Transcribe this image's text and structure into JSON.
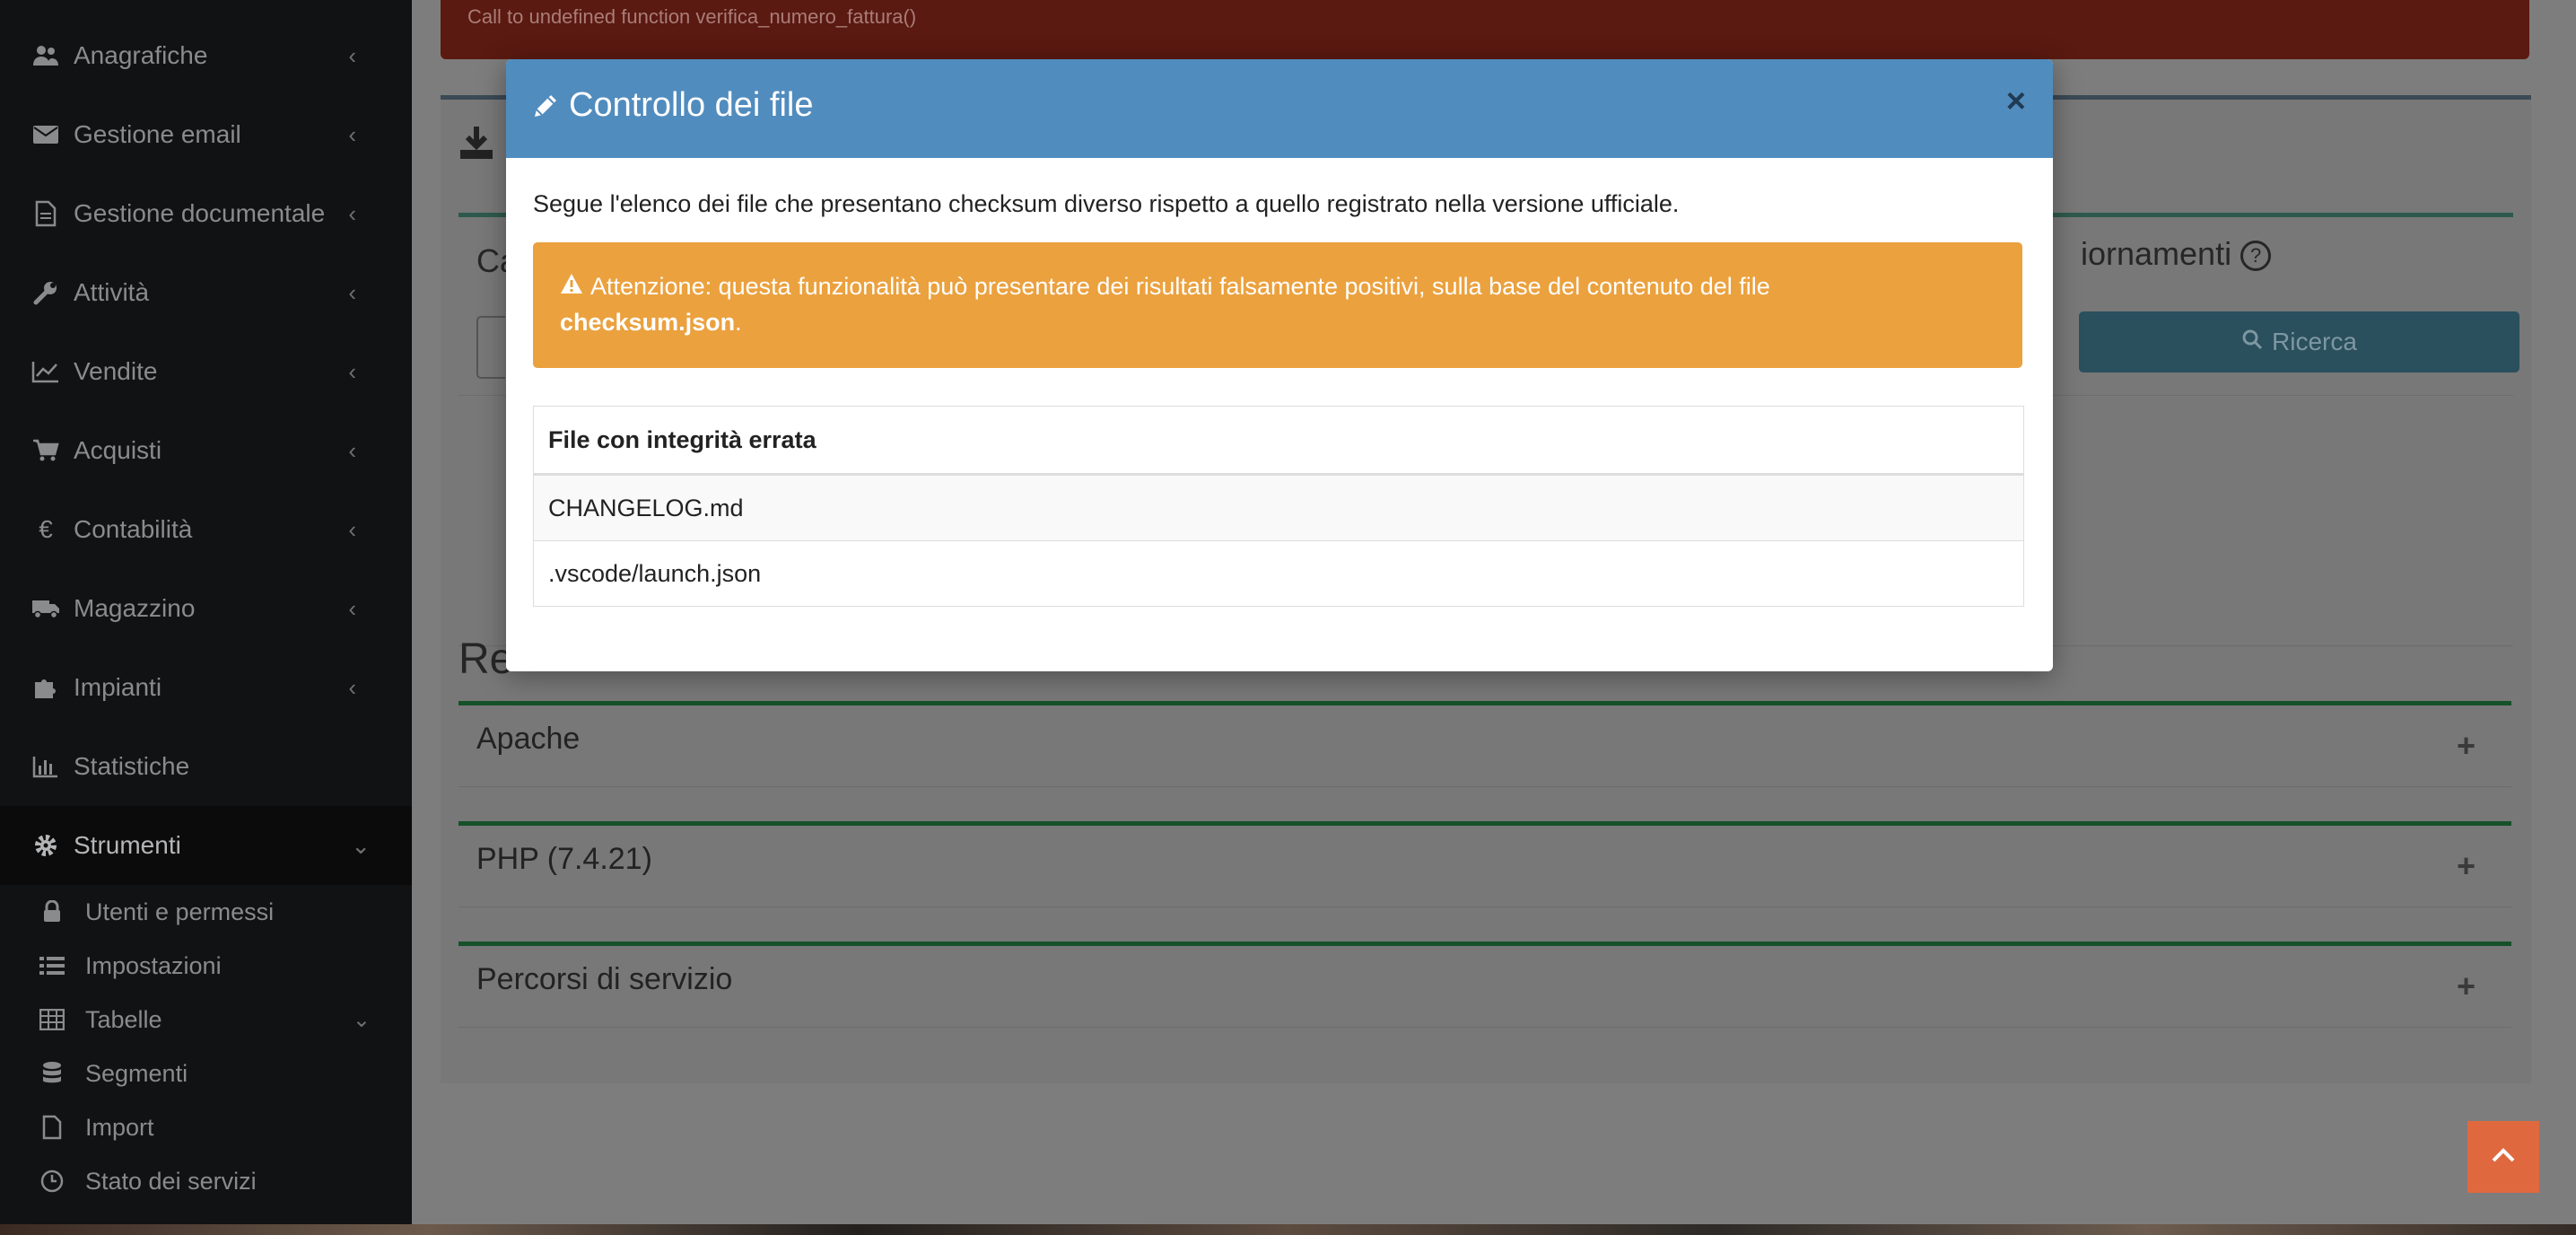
{
  "sidebar": {
    "items": [
      {
        "label": "Anagrafiche",
        "icon": "users-icon"
      },
      {
        "label": "Gestione email",
        "icon": "envelope-icon"
      },
      {
        "label": "Gestione documentale",
        "icon": "document-icon"
      },
      {
        "label": "Attività",
        "icon": "wrench-icon"
      },
      {
        "label": "Vendite",
        "icon": "line-chart-icon"
      },
      {
        "label": "Acquisti",
        "icon": "cart-icon"
      },
      {
        "label": "Contabilità",
        "icon": "euro-icon"
      },
      {
        "label": "Magazzino",
        "icon": "truck-icon"
      },
      {
        "label": "Impianti",
        "icon": "puzzle-icon"
      },
      {
        "label": "Statistiche",
        "icon": "bar-chart-icon"
      },
      {
        "label": "Strumenti",
        "icon": "gear-icon"
      }
    ],
    "subitems": [
      {
        "label": "Utenti e permessi",
        "icon": "lock-icon"
      },
      {
        "label": "Impostazioni",
        "icon": "list-icon"
      },
      {
        "label": "Tabelle",
        "icon": "table-icon"
      },
      {
        "label": "Segmenti",
        "icon": "database-icon"
      },
      {
        "label": "Import",
        "icon": "file-icon"
      },
      {
        "label": "Stato dei servizi",
        "icon": "clock-icon"
      }
    ]
  },
  "background": {
    "error_message": "Call to undefined function verifica_numero_fattura()",
    "section_title_right": "iornamenti",
    "search_button": "Ricerca",
    "panel_left_fragment": "Ca",
    "requisiti_fragment": "Re",
    "panels": [
      {
        "title": "Apache"
      },
      {
        "title": "PHP (7.4.21)"
      },
      {
        "title": "Percorsi di servizio"
      }
    ]
  },
  "modal": {
    "title": "Controllo dei file",
    "close": "×",
    "description": "Segue l'elenco dei file che presentano checksum diverso rispetto a quello registrato nella versione ufficiale.",
    "warning": {
      "text": "Attenzione: questa funzionalità può presentare dei risultati falsamente positivi, sulla base del contenuto del file",
      "filename": "checksum.json",
      "suffix": "."
    },
    "table": {
      "header": "File con integrità errata",
      "rows": [
        "CHANGELOG.md",
        ".vscode/launch.json"
      ]
    }
  },
  "colors": {
    "modal_header": "#518cbe",
    "warning": "#eba13e",
    "scroll_top": "#e0683f",
    "sidebar": "#111213"
  }
}
